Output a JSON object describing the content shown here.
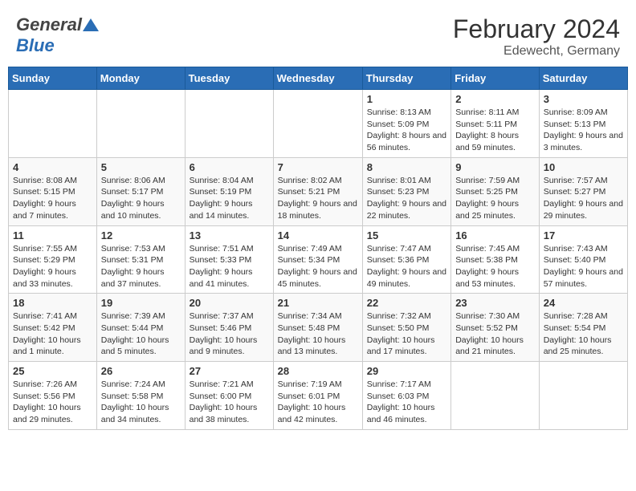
{
  "header": {
    "logo_general": "General",
    "logo_blue": "Blue",
    "month_year": "February 2024",
    "location": "Edewecht, Germany"
  },
  "days_of_week": [
    "Sunday",
    "Monday",
    "Tuesday",
    "Wednesday",
    "Thursday",
    "Friday",
    "Saturday"
  ],
  "weeks": [
    [
      {
        "day": "",
        "info": ""
      },
      {
        "day": "",
        "info": ""
      },
      {
        "day": "",
        "info": ""
      },
      {
        "day": "",
        "info": ""
      },
      {
        "day": "1",
        "info": "Sunrise: 8:13 AM\nSunset: 5:09 PM\nDaylight: 8 hours and 56 minutes."
      },
      {
        "day": "2",
        "info": "Sunrise: 8:11 AM\nSunset: 5:11 PM\nDaylight: 8 hours and 59 minutes."
      },
      {
        "day": "3",
        "info": "Sunrise: 8:09 AM\nSunset: 5:13 PM\nDaylight: 9 hours and 3 minutes."
      }
    ],
    [
      {
        "day": "4",
        "info": "Sunrise: 8:08 AM\nSunset: 5:15 PM\nDaylight: 9 hours and 7 minutes."
      },
      {
        "day": "5",
        "info": "Sunrise: 8:06 AM\nSunset: 5:17 PM\nDaylight: 9 hours and 10 minutes."
      },
      {
        "day": "6",
        "info": "Sunrise: 8:04 AM\nSunset: 5:19 PM\nDaylight: 9 hours and 14 minutes."
      },
      {
        "day": "7",
        "info": "Sunrise: 8:02 AM\nSunset: 5:21 PM\nDaylight: 9 hours and 18 minutes."
      },
      {
        "day": "8",
        "info": "Sunrise: 8:01 AM\nSunset: 5:23 PM\nDaylight: 9 hours and 22 minutes."
      },
      {
        "day": "9",
        "info": "Sunrise: 7:59 AM\nSunset: 5:25 PM\nDaylight: 9 hours and 25 minutes."
      },
      {
        "day": "10",
        "info": "Sunrise: 7:57 AM\nSunset: 5:27 PM\nDaylight: 9 hours and 29 minutes."
      }
    ],
    [
      {
        "day": "11",
        "info": "Sunrise: 7:55 AM\nSunset: 5:29 PM\nDaylight: 9 hours and 33 minutes."
      },
      {
        "day": "12",
        "info": "Sunrise: 7:53 AM\nSunset: 5:31 PM\nDaylight: 9 hours and 37 minutes."
      },
      {
        "day": "13",
        "info": "Sunrise: 7:51 AM\nSunset: 5:33 PM\nDaylight: 9 hours and 41 minutes."
      },
      {
        "day": "14",
        "info": "Sunrise: 7:49 AM\nSunset: 5:34 PM\nDaylight: 9 hours and 45 minutes."
      },
      {
        "day": "15",
        "info": "Sunrise: 7:47 AM\nSunset: 5:36 PM\nDaylight: 9 hours and 49 minutes."
      },
      {
        "day": "16",
        "info": "Sunrise: 7:45 AM\nSunset: 5:38 PM\nDaylight: 9 hours and 53 minutes."
      },
      {
        "day": "17",
        "info": "Sunrise: 7:43 AM\nSunset: 5:40 PM\nDaylight: 9 hours and 57 minutes."
      }
    ],
    [
      {
        "day": "18",
        "info": "Sunrise: 7:41 AM\nSunset: 5:42 PM\nDaylight: 10 hours and 1 minute."
      },
      {
        "day": "19",
        "info": "Sunrise: 7:39 AM\nSunset: 5:44 PM\nDaylight: 10 hours and 5 minutes."
      },
      {
        "day": "20",
        "info": "Sunrise: 7:37 AM\nSunset: 5:46 PM\nDaylight: 10 hours and 9 minutes."
      },
      {
        "day": "21",
        "info": "Sunrise: 7:34 AM\nSunset: 5:48 PM\nDaylight: 10 hours and 13 minutes."
      },
      {
        "day": "22",
        "info": "Sunrise: 7:32 AM\nSunset: 5:50 PM\nDaylight: 10 hours and 17 minutes."
      },
      {
        "day": "23",
        "info": "Sunrise: 7:30 AM\nSunset: 5:52 PM\nDaylight: 10 hours and 21 minutes."
      },
      {
        "day": "24",
        "info": "Sunrise: 7:28 AM\nSunset: 5:54 PM\nDaylight: 10 hours and 25 minutes."
      }
    ],
    [
      {
        "day": "25",
        "info": "Sunrise: 7:26 AM\nSunset: 5:56 PM\nDaylight: 10 hours and 29 minutes."
      },
      {
        "day": "26",
        "info": "Sunrise: 7:24 AM\nSunset: 5:58 PM\nDaylight: 10 hours and 34 minutes."
      },
      {
        "day": "27",
        "info": "Sunrise: 7:21 AM\nSunset: 6:00 PM\nDaylight: 10 hours and 38 minutes."
      },
      {
        "day": "28",
        "info": "Sunrise: 7:19 AM\nSunset: 6:01 PM\nDaylight: 10 hours and 42 minutes."
      },
      {
        "day": "29",
        "info": "Sunrise: 7:17 AM\nSunset: 6:03 PM\nDaylight: 10 hours and 46 minutes."
      },
      {
        "day": "",
        "info": ""
      },
      {
        "day": "",
        "info": ""
      }
    ]
  ]
}
